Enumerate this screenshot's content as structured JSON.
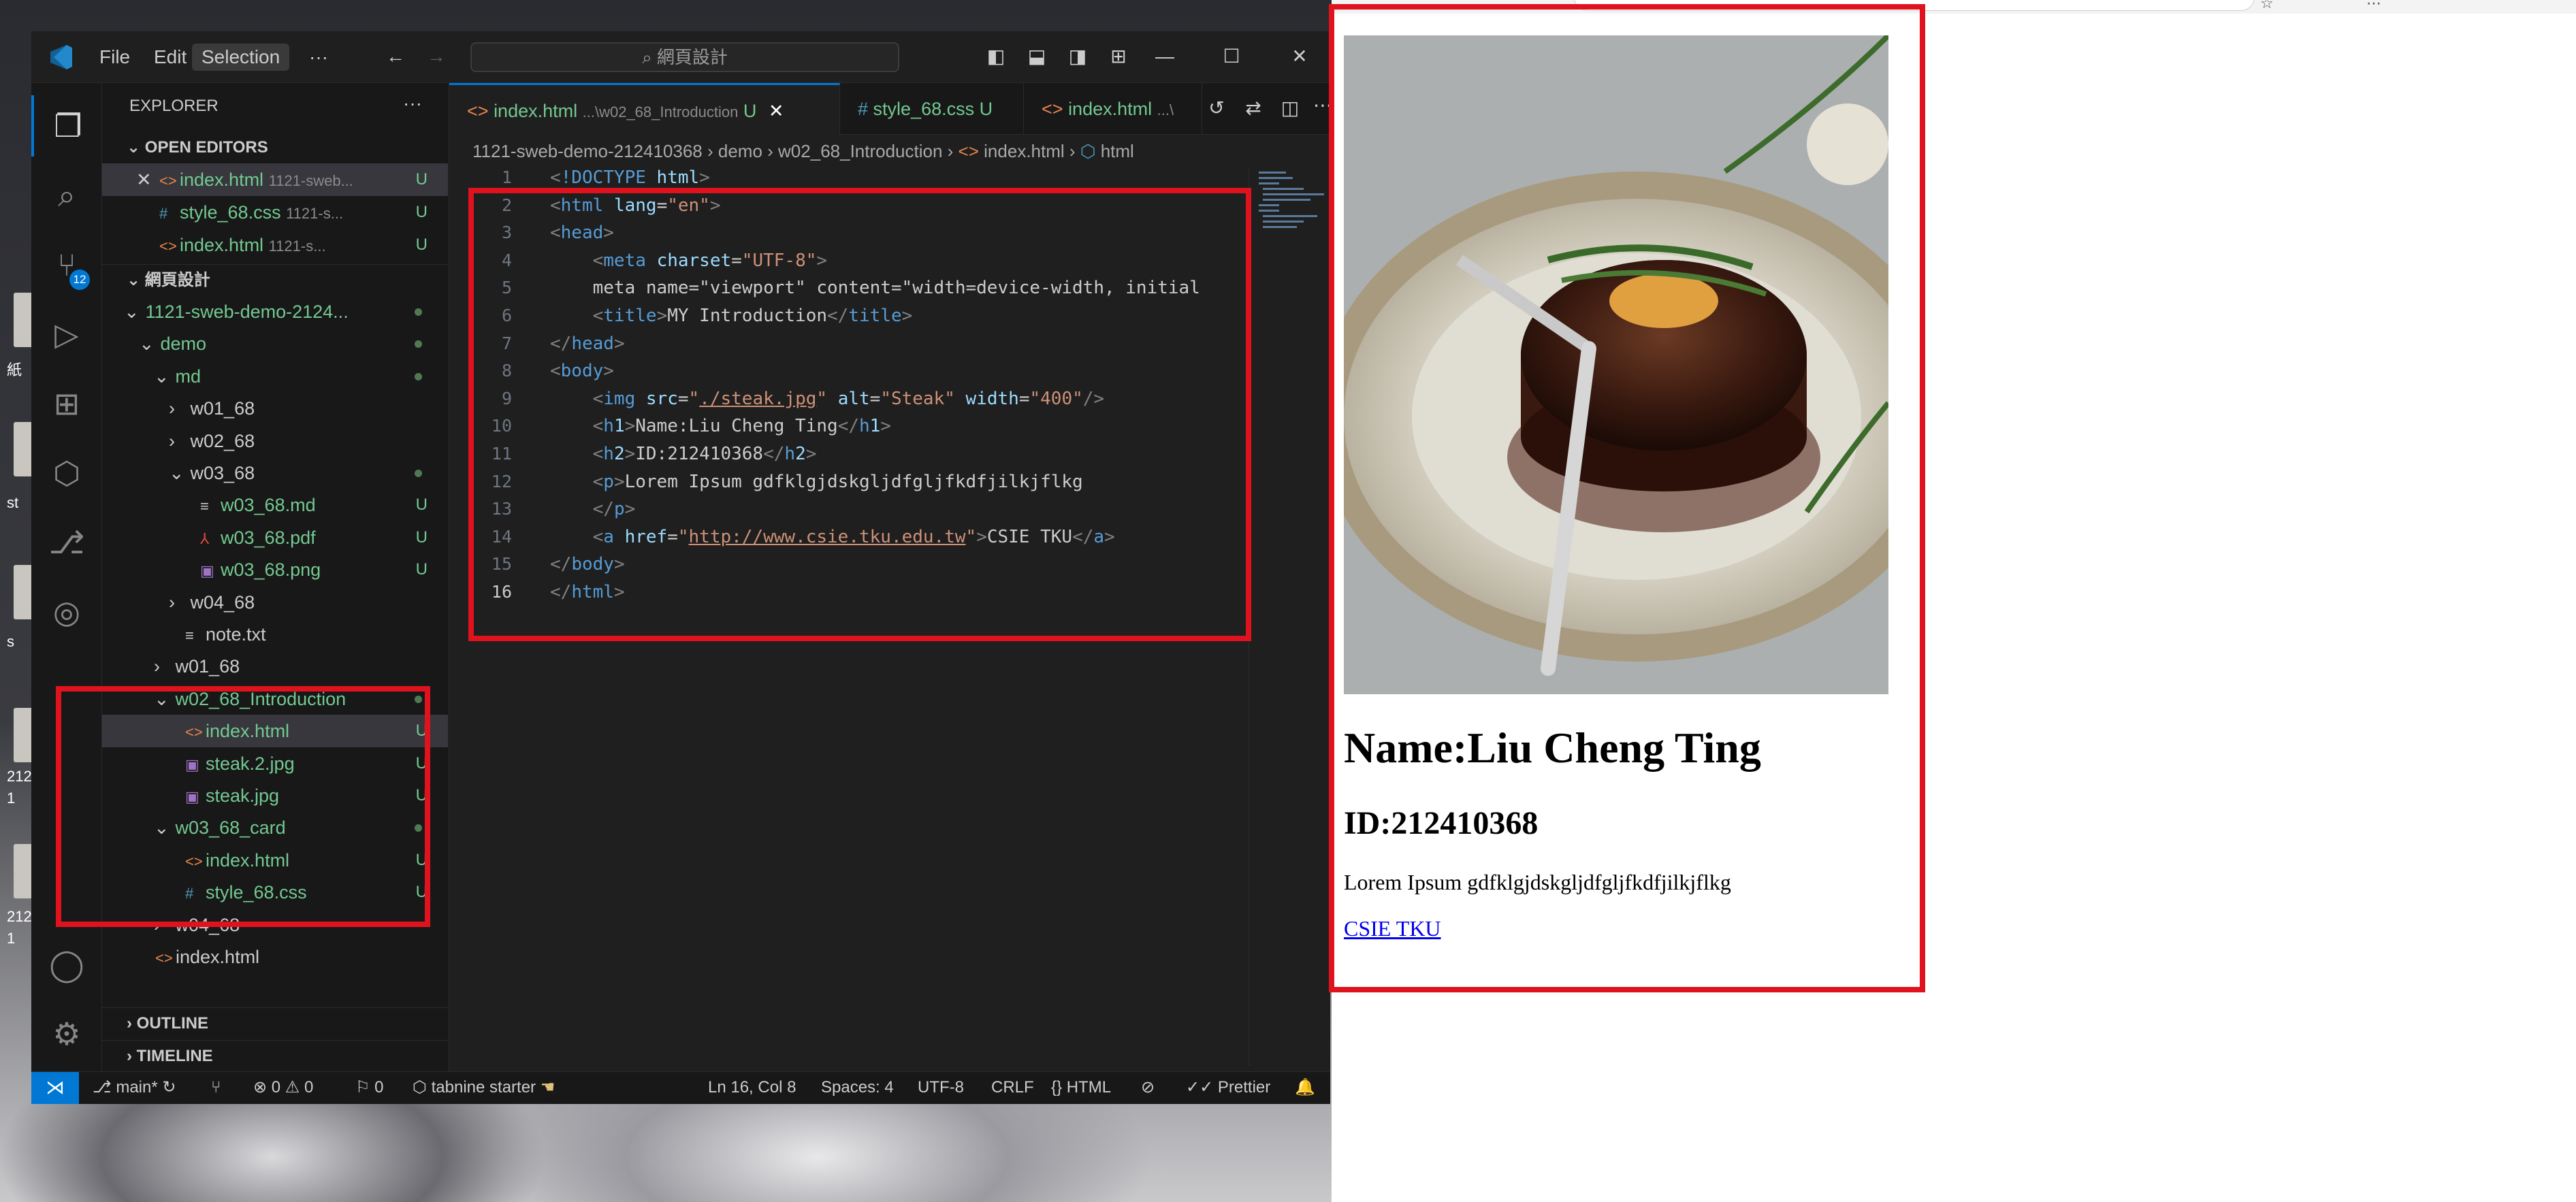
{
  "desktop": {
    "labels": [
      "st",
      "s",
      "212",
      "1",
      "212",
      "1",
      "紙"
    ]
  },
  "vscode": {
    "menu": [
      "File",
      "Edit",
      "Selection"
    ],
    "more": "···",
    "search": "網頁設計",
    "explorer_title": "EXPLORER",
    "explorer_more": "···",
    "open_editors": "OPEN EDITORS",
    "open_files": [
      {
        "name": "index.html",
        "path": "1121-sweb...",
        "status": "U",
        "close": "✕"
      },
      {
        "name": "style_68.css",
        "path": "1121-s...",
        "status": "U"
      },
      {
        "name": "index.html",
        "path": "1121-s...",
        "status": "U"
      }
    ],
    "workspace": "網頁設計",
    "tree": [
      {
        "label": "1121-sweb-demo-2124...",
        "depth": 1,
        "kind": "folder-open"
      },
      {
        "label": "demo",
        "depth": 2,
        "kind": "folder-open"
      },
      {
        "label": "md",
        "depth": 3,
        "kind": "folder-open"
      },
      {
        "label": "w01_68",
        "depth": 4,
        "kind": "folder"
      },
      {
        "label": "w02_68",
        "depth": 4,
        "kind": "folder"
      },
      {
        "label": "w03_68",
        "depth": 4,
        "kind": "folder-open"
      },
      {
        "label": "w03_68.md",
        "depth": 5,
        "kind": "md",
        "status": "U"
      },
      {
        "label": "w03_68.pdf",
        "depth": 5,
        "kind": "pdf",
        "status": "U"
      },
      {
        "label": "w03_68.png",
        "depth": 5,
        "kind": "img",
        "status": "U"
      },
      {
        "label": "w04_68",
        "depth": 4,
        "kind": "folder"
      },
      {
        "label": "note.txt",
        "depth": 4,
        "kind": "txt"
      },
      {
        "label": "w01_68",
        "depth": 3,
        "kind": "folder"
      },
      {
        "label": "w02_68_Introduction",
        "depth": 3,
        "kind": "folder-open"
      },
      {
        "label": "index.html",
        "depth": 4,
        "kind": "html",
        "status": "U",
        "selected": true
      },
      {
        "label": "steak.2.jpg",
        "depth": 4,
        "kind": "img",
        "status": "U"
      },
      {
        "label": "steak.jpg",
        "depth": 4,
        "kind": "img",
        "status": "U"
      },
      {
        "label": "w03_68_card",
        "depth": 3,
        "kind": "folder-open"
      },
      {
        "label": "index.html",
        "depth": 4,
        "kind": "html",
        "status": "U"
      },
      {
        "label": "style_68.css",
        "depth": 4,
        "kind": "css",
        "status": "U"
      },
      {
        "label": "w04_68",
        "depth": 3,
        "kind": "folder"
      },
      {
        "label": "index.html",
        "depth": 2,
        "kind": "html"
      }
    ],
    "outline": "OUTLINE",
    "timeline": "TIMELINE",
    "tabs": [
      {
        "name": "index.html",
        "desc": "...\\w02_68_Introduction",
        "status": "U",
        "active": true
      },
      {
        "name": "style_68.css",
        "status": "U"
      },
      {
        "name": "index.html",
        "desc": "...\\"
      }
    ],
    "breadcrumb": [
      "1121-sweb-demo-212410368",
      "demo",
      "w02_68_Introduction",
      "index.html",
      "html"
    ],
    "code": [
      "<!DOCTYPE html>",
      "<html lang=\"en\">",
      "<head>",
      "    <meta charset=\"UTF-8\">",
      "    <meta name=\"viewport\" content=\"width=device-width, initial",
      "    <title>MY Introduction</title>",
      "</head>",
      "<body>",
      "    <img src=\"./steak.jpg\" alt=\"Steak\" width=\"400\"/>",
      "    <h1>Name:Liu Cheng Ting</h1>",
      "    <h2>ID:212410368</h2>",
      "    <p>Lorem Ipsum gdfklgjdskgljdfgljfkdfjilkjflkg",
      "    </p>",
      "    <a href=\"http://www.csie.tku.edu.tw\">CSIE TKU</a>",
      "</body>",
      "</html>"
    ],
    "status": {
      "branch": "main*",
      "problems": "⊗ 0 ⚠ 0",
      "ports": "⚐ 0",
      "tabnine": "tabnine starter",
      "position": "Ln 16, Col 8",
      "spaces": "Spaces: 4",
      "encoding": "UTF-8",
      "eol": "CRLF",
      "language": "HTML",
      "prettier": "Prettier"
    },
    "scm_badge": "12"
  },
  "browser": {
    "image_alt": "Steak",
    "h1": "Name:Liu Cheng Ting",
    "h2": "ID:212410368",
    "paragraph": "Lorem Ipsum gdfklgjdskgljdfgljfkdfjilkjflkg",
    "link": "CSIE TKU"
  },
  "colors": {
    "accent": "#0078d4",
    "annotation": "#e0121d",
    "untracked": "#73c991"
  }
}
